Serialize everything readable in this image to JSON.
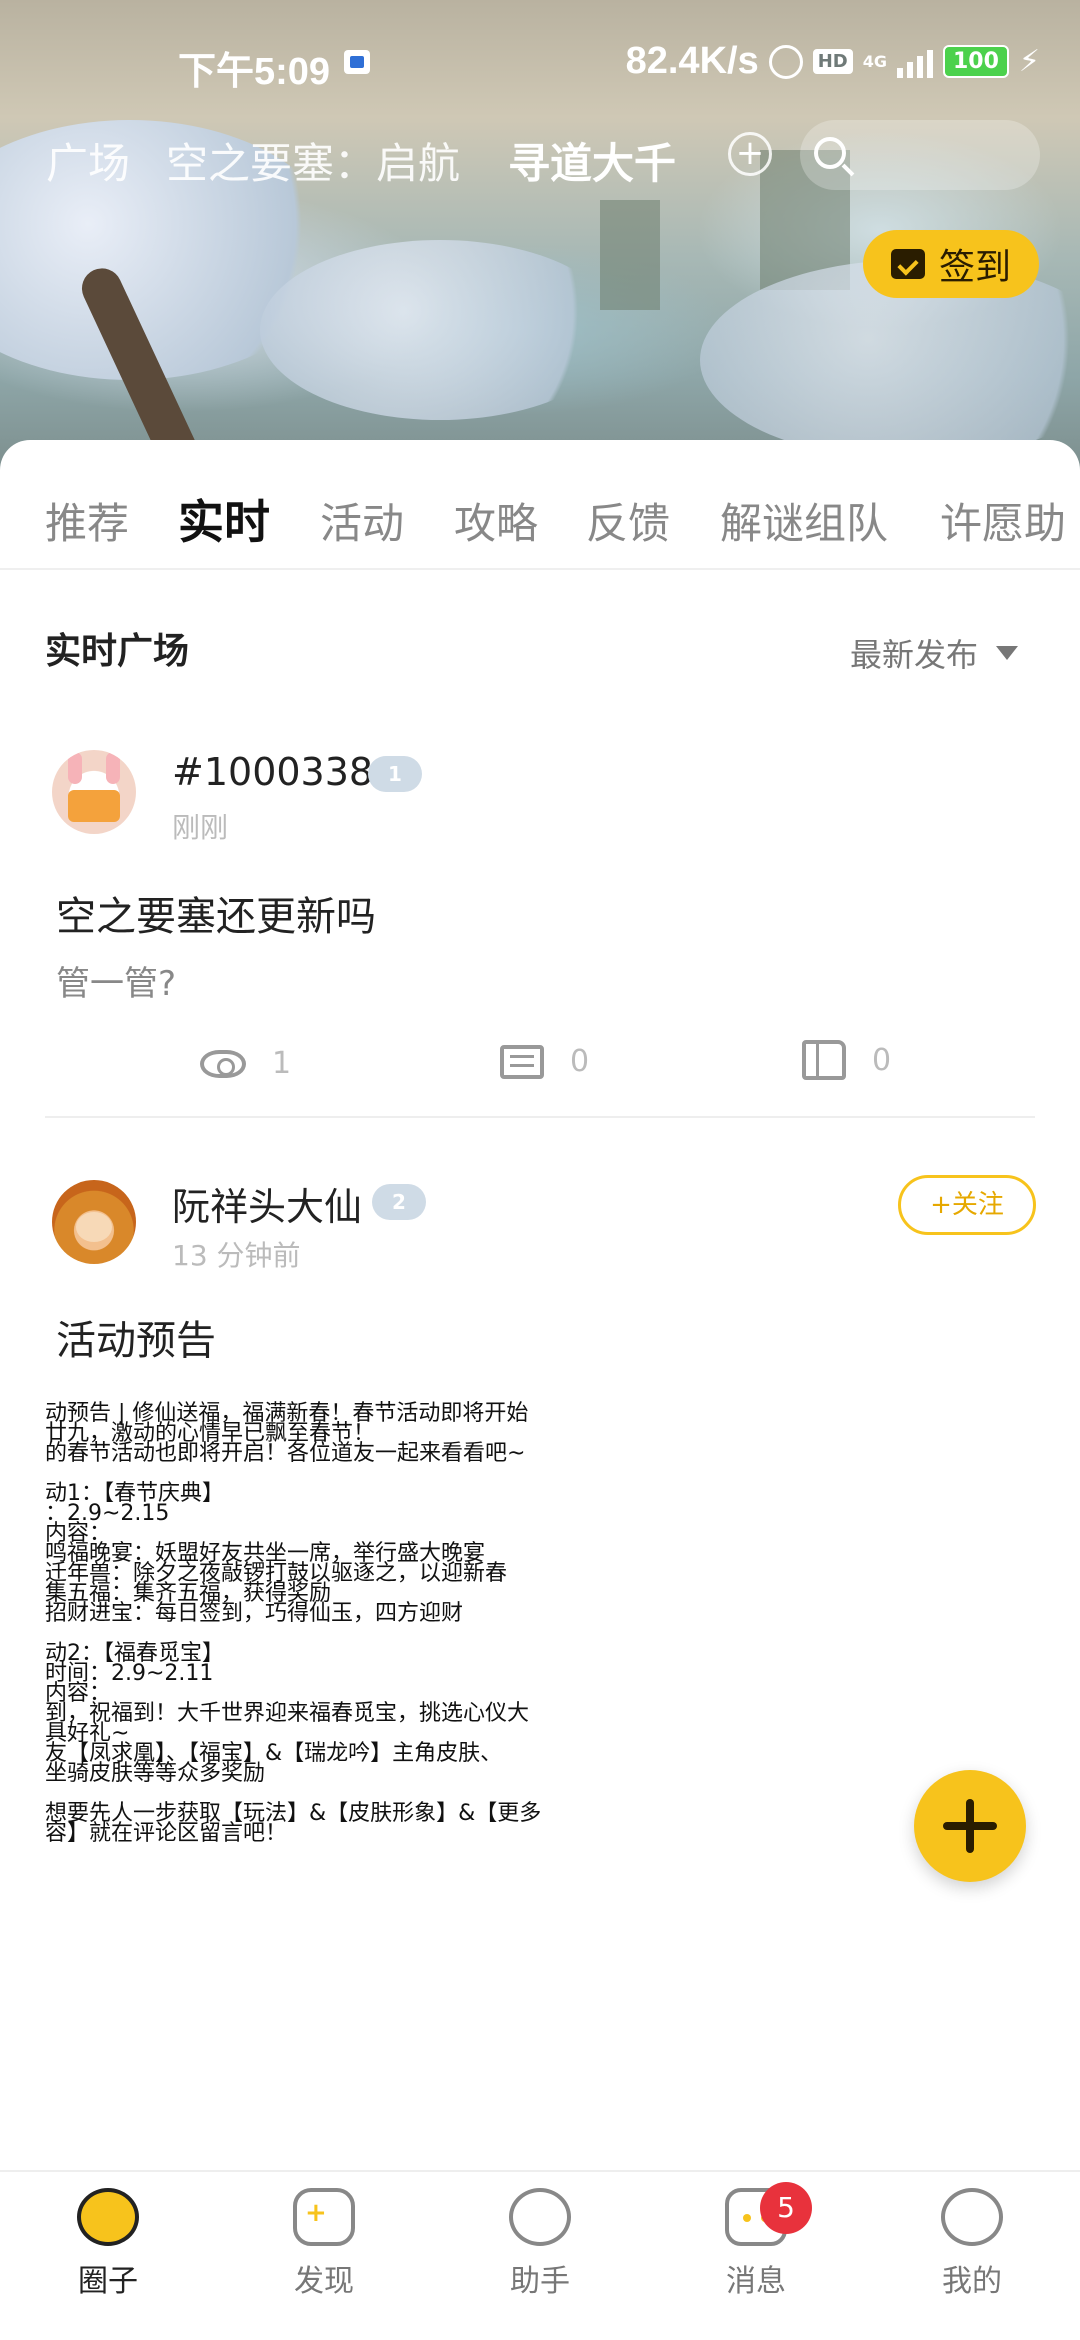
{
  "status": {
    "time": "下午5:09",
    "net_speed": "82.4K/s",
    "hd": "HD",
    "network": "4G",
    "battery": "100"
  },
  "top_nav": {
    "items": [
      "广场",
      "空之要塞：启航",
      "寻道大千"
    ],
    "active_index": 2
  },
  "checkin": {
    "label": "签到"
  },
  "tabs": [
    "推荐",
    "实时",
    "活动",
    "攻略",
    "反馈",
    "解谜组队",
    "许愿助"
  ],
  "active_tab": "实时",
  "section": {
    "title": "实时广场",
    "sort_label": "最新发布"
  },
  "posts": [
    {
      "name": "#1000338",
      "level": "1",
      "time": "刚刚",
      "title": "空之要塞还更新吗",
      "subtitle": "管一管?",
      "views": "1",
      "comments": "0",
      "likes": "0"
    },
    {
      "name": "阮祥头大仙",
      "level": "2",
      "time": "13 分钟前",
      "follow_label": "+关注",
      "title": "活动预告",
      "image_lines": [
        "动预告 | 修仙送福，福满新春！春节活动即将开始",
        "廿九，激动的心情早已飘至春节！",
        "的春节活动也即将开启！各位道友一起来看看吧~",
        "",
        "动1：【春节庆典】",
        "：2.9~2.15",
        "内容：",
        "鸣福晚宴：妖盟好友共坐一席，举行盛大晚宴",
        "迁年兽：除夕之夜敲锣打鼓以驱逐之，以迎新春",
        "集五福：集齐五福，获得奖励",
        "招财进宝：每日签到，巧得仙玉，四方迎财",
        "",
        "动2：【福春觅宝】",
        "时间：2.9~2.11",
        "内容：",
        "到，祝福到！大千世界迎来福春觅宝，挑选心仪大",
        "具好礼~",
        "友【凤求凰】、【福宝】&【瑞龙吟】主角皮肤、",
        "坐骑皮肤等等众多奖励",
        "",
        "想要先人一步获取【玩法】&【皮肤形象】&【更多",
        "容】就在评论区留言吧！"
      ]
    }
  ],
  "bottom_nav": [
    {
      "label": "圈子",
      "icon": "circle-icon",
      "active": true
    },
    {
      "label": "发现",
      "icon": "gamepad-icon",
      "active": false
    },
    {
      "label": "助手",
      "icon": "assistant-icon",
      "active": false
    },
    {
      "label": "消息",
      "icon": "message-icon",
      "active": false,
      "badge": "5"
    },
    {
      "label": "我的",
      "icon": "profile-icon",
      "active": false
    }
  ],
  "colors": {
    "accent": "#f7c31c",
    "badge": "#e8323c"
  }
}
